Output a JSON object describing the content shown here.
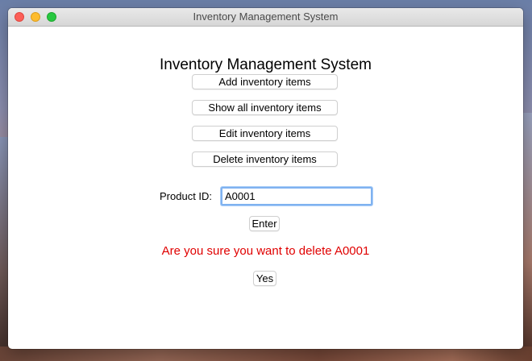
{
  "window": {
    "title": "Inventory Management System"
  },
  "main": {
    "heading": "Inventory Management System",
    "buttons": [
      {
        "label": "Add inventory items"
      },
      {
        "label": "Show all inventory items"
      },
      {
        "label": "Edit inventory items"
      },
      {
        "label": "Delete inventory items"
      }
    ],
    "product_id": {
      "label": "Product ID:",
      "value": "A0001"
    },
    "enter_label": "Enter",
    "confirm_message": "Are you sure you want to delete A0001",
    "yes_label": "Yes"
  },
  "colors": {
    "confirm_text": "#e00000",
    "focus_ring": "#7fb2f0"
  }
}
